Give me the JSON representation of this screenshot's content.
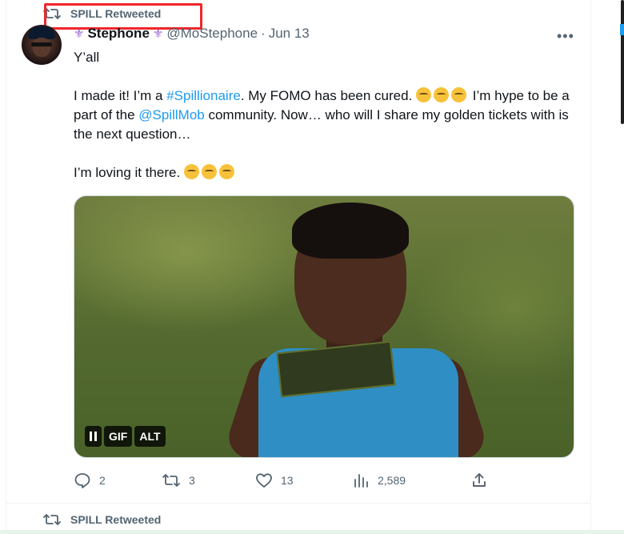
{
  "retweet_header": {
    "label": "SPILL Retweeted"
  },
  "author": {
    "name": "Stephone",
    "handle": "@MoStephone",
    "separator": "·",
    "date": "Jun 13",
    "more_label": "•••"
  },
  "tweet": {
    "line1": "Y’all",
    "p2_before_hashtag": "I made it! I’m a ",
    "hashtag": "#Spillionaire",
    "p2_after_hashtag": ". My FOMO has been cured. ",
    "p2_after_emoji": " I’m hype to be a part of the ",
    "mention": "@SpillMob",
    "p2_end": " community. Now… who will I share my golden tickets with is the next question…",
    "p3": "I’m loving it there. "
  },
  "media": {
    "badges": {
      "gif": "GIF",
      "alt": "ALT"
    }
  },
  "actions": {
    "replies": "2",
    "retweets": "3",
    "likes": "13",
    "views": "2,589"
  },
  "next_retweet_header": {
    "label": "SPILL Retweeted"
  },
  "colors": {
    "accent": "#1d9bf0",
    "secondary_text": "#536471",
    "highlight_box": "#f0262b"
  }
}
